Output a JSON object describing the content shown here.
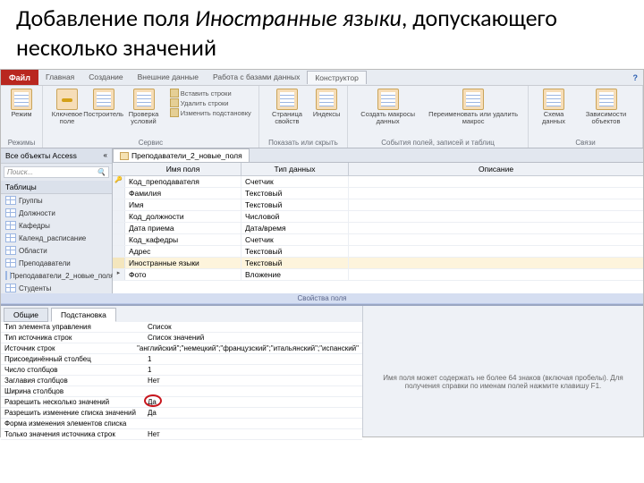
{
  "slide": {
    "title_pre": "Добавление поля ",
    "title_italic": "Иностранные языки",
    "title_post": ", допускающего несколько значений"
  },
  "menubar": {
    "file": "Файл",
    "tabs": [
      "Главная",
      "Создание",
      "Внешние данные",
      "Работа с базами данных",
      "Конструктор"
    ],
    "help": "?"
  },
  "ribbon": {
    "groups": [
      {
        "label": "Режимы",
        "big": [
          {
            "icon": "grid",
            "text": "Режим"
          }
        ]
      },
      {
        "label": "Сервис",
        "big": [
          {
            "icon": "key",
            "text": "Ключевое поле"
          },
          {
            "icon": "grid",
            "text": "Построитель"
          },
          {
            "icon": "grid",
            "text": "Проверка условий"
          }
        ],
        "small": [
          "Вставить строки",
          "Удалить строки",
          "Изменить подстановку"
        ]
      },
      {
        "label": "Показать или скрыть",
        "big": [
          {
            "icon": "grid",
            "text": "Страница свойств"
          },
          {
            "icon": "grid",
            "text": "Индексы"
          }
        ]
      },
      {
        "label": "События полей, записей и таблиц",
        "big": [
          {
            "icon": "grid",
            "text": "Создать макросы данных"
          },
          {
            "icon": "grid",
            "text": "Переименовать или удалить макрос"
          }
        ]
      },
      {
        "label": "Связи",
        "big": [
          {
            "icon": "grid",
            "text": "Схема данных"
          },
          {
            "icon": "grid",
            "text": "Зависимости объектов"
          }
        ]
      }
    ]
  },
  "nav": {
    "header": "Все объекты Access",
    "search": "Поиск...",
    "category": "Таблицы",
    "items": [
      "Группы",
      "Должности",
      "Кафедры",
      "Календ_расписание",
      "Области",
      "Преподаватели",
      "Преподаватели_2_новые_поля",
      "Студенты"
    ]
  },
  "doc": {
    "tab": "Преподаватели_2_новые_поля",
    "columns": {
      "name": "Имя поля",
      "type": "Тип данных",
      "desc": "Описание"
    },
    "rows": [
      {
        "name": "Код_преподавателя",
        "type": "Счетчик",
        "key": true
      },
      {
        "name": "Фамилия",
        "type": "Текстовый"
      },
      {
        "name": "Имя",
        "type": "Текстовый"
      },
      {
        "name": "Код_должности",
        "type": "Числовой"
      },
      {
        "name": "Дата приема",
        "type": "Дата/время"
      },
      {
        "name": "Код_кафедры",
        "type": "Счетчик"
      },
      {
        "name": "Адрес",
        "type": "Текстовый"
      },
      {
        "name": "Иностранные языки",
        "type": "Текстовый",
        "hl": true
      },
      {
        "name": "Фото",
        "type": "Вложение",
        "ptr": true
      }
    ]
  },
  "props": {
    "caption": "Свойства поля",
    "tabs": [
      "Общие",
      "Подстановка"
    ],
    "active": 1,
    "rows": [
      {
        "l": "Тип элемента управления",
        "v": "Список"
      },
      {
        "l": "Тип источника строк",
        "v": "Список значений"
      },
      {
        "l": "Источник строк",
        "v": "\"английский\";\"немецкий\";\"французский\";\"итальянский\";\"испанский\""
      },
      {
        "l": "Присоединённый столбец",
        "v": "1"
      },
      {
        "l": "Число столбцов",
        "v": "1"
      },
      {
        "l": "Заглавия столбцов",
        "v": "Нет"
      },
      {
        "l": "Ширина столбцов",
        "v": ""
      },
      {
        "l": "Разрешить несколько значений",
        "v": "Да",
        "circle": true
      },
      {
        "l": "Разрешить изменение списка значений",
        "v": "Да"
      },
      {
        "l": "Форма изменения элементов списка",
        "v": ""
      },
      {
        "l": "Только значения источника строк",
        "v": "Нет"
      }
    ],
    "help": "Имя поля может содержать не более 64 знаков (включая пробелы). Для получения справки по именам полей нажмите клавишу F1."
  }
}
